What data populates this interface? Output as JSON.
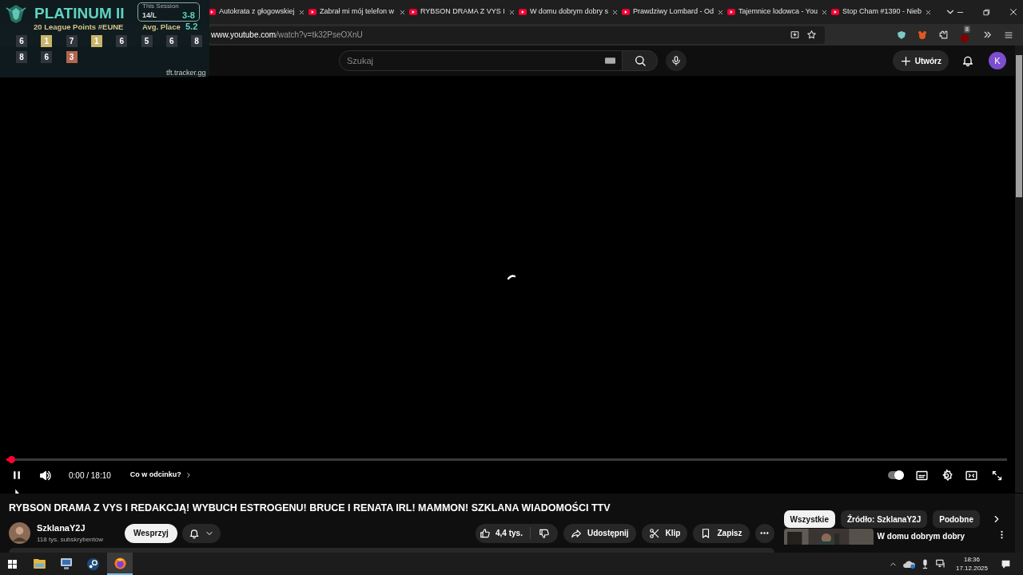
{
  "overlay": {
    "rank": "PLATINUM II",
    "points": "20 League Points #EUNE",
    "session_label": "This Session",
    "session_record": "14/L",
    "session_score": "3-8",
    "avg_label": "Avg. Place",
    "avg_value": "5.2",
    "source": "tft.tracker.gg",
    "placements": [
      {
        "value": "6",
        "color": "#30363b"
      },
      {
        "value": "1",
        "color": "#c9b46a"
      },
      {
        "value": "7",
        "color": "#30363b"
      },
      {
        "value": "1",
        "color": "#c9b46a"
      },
      {
        "value": "6",
        "color": "#30363b"
      },
      {
        "value": "5",
        "color": "#30363b"
      },
      {
        "value": "6",
        "color": "#30363b"
      },
      {
        "value": "8",
        "color": "#30363b"
      },
      {
        "value": "8",
        "color": "#30363b"
      },
      {
        "value": "6",
        "color": "#30363b"
      },
      {
        "value": "3",
        "color": "#b0664f"
      }
    ]
  },
  "tabs": [
    {
      "title": "Autokrata z głogowskiej"
    },
    {
      "title": "Zabrał mi mój telefon w"
    },
    {
      "title": "RYBSON DRAMA Z VYS I"
    },
    {
      "title": "W domu dobrym dobry s"
    },
    {
      "title": "Prawdziwy Lombard - Od"
    },
    {
      "title": "Tajemnice lodowca - You"
    },
    {
      "title": "Stop Cham #1390 - Nieb"
    }
  ],
  "address_bar": {
    "url_host": "www.youtube.com",
    "url_path": "/watch?v=tk32PseOXnU",
    "extension_badge": "8"
  },
  "header": {
    "search_placeholder": "Szukaj",
    "create_label": "Utwórz",
    "avatar_letter": "K"
  },
  "player": {
    "playing": true,
    "level": 0.005,
    "time": "0:00 / 18:10",
    "chapters_label": "Co w odcinku?",
    "autoplay": true
  },
  "video": {
    "title": "RYBSON DRAMA Z VYS I REDAKCJĄ! WYBUCH ESTROGENU! BRUCE I RENATA IRL! MAMMON! SZKLANA WIADOMOŚCI TTV",
    "channel": "SzklanaY2J",
    "subscribers": "118 tys. subskrybentów",
    "support_label": "Wesprzyj",
    "likes": "4,4 tys.",
    "share_label": "Udostępnij",
    "clip_label": "Klip",
    "save_label": "Zapisz"
  },
  "chips": [
    {
      "label": "Wszystkie",
      "selected": true
    },
    {
      "label": "Źródło: SzklanaY2J",
      "selected": false
    },
    {
      "label": "Podobne",
      "selected": false
    }
  ],
  "recommendation": {
    "title": "W domu dobrym dobry"
  },
  "taskbar": {
    "time": "18:36",
    "date": "17.12.2025"
  }
}
